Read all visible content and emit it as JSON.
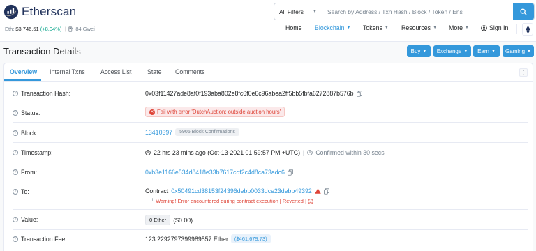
{
  "brand": {
    "name": "Etherscan"
  },
  "eth_info": {
    "label": "Eth: ",
    "price": "$3,746.51",
    "change": "(+8.04%)",
    "separator": "|",
    "gas": "84 Gwei"
  },
  "search": {
    "filter": "All Filters",
    "placeholder": "Search by Address / Txn Hash / Block / Token / Ens"
  },
  "nav": {
    "items": [
      {
        "label": "Home"
      },
      {
        "label": "Blockchain"
      },
      {
        "label": "Tokens"
      },
      {
        "label": "Resources"
      },
      {
        "label": "More"
      },
      {
        "label": "Sign In"
      }
    ]
  },
  "page": {
    "title": "Transaction Details"
  },
  "actions": [
    {
      "label": "Buy"
    },
    {
      "label": "Exchange"
    },
    {
      "label": "Earn"
    },
    {
      "label": "Gaming"
    }
  ],
  "tabs": [
    {
      "label": "Overview"
    },
    {
      "label": "Internal Txns"
    },
    {
      "label": "Access List"
    },
    {
      "label": "State"
    },
    {
      "label": "Comments"
    }
  ],
  "details": {
    "tx_hash": {
      "label": "Transaction Hash:",
      "value": "0x03f11427ade8af0f193aba802e8fc6f0e6c96abea2ff5bb5fbfa6272887b576b"
    },
    "status": {
      "label": "Status:",
      "value": "Fail with error 'DutchAuction: outside auction hours'"
    },
    "block": {
      "label": "Block:",
      "value": "13410397",
      "confirmations": "5905 Block Confirmations"
    },
    "timestamp": {
      "label": "Timestamp:",
      "value": "22 hrs 23 mins ago (Oct-13-2021 01:59:57 PM +UTC)",
      "separator": "|",
      "confirmed": "Confirmed within 30 secs"
    },
    "from": {
      "label": "From:",
      "value": "0xb3e1166e534d8418e33b7617cdf2c4d8ca73adc6"
    },
    "to": {
      "label": "To:",
      "prefix": "Contract",
      "value": "0x50491cd38153f24396debb0033dce23debb49392",
      "warning_arrow": "└",
      "warning": "Warning! Error encountered during contract execution [",
      "warning_tag": "Reverted",
      "warning_end": "]"
    },
    "value": {
      "label": "Value:",
      "amount": "0 Ether",
      "usd": "($0.00)"
    },
    "fee": {
      "label": "Transaction Fee:",
      "value": "123.2292797399989557 Ether",
      "usd": "($461,679.73)"
    }
  },
  "colors": {
    "accent": "#3498db",
    "danger": "#de4437",
    "success": "#00a186",
    "text": "#1e2022",
    "muted": "#77838f"
  }
}
